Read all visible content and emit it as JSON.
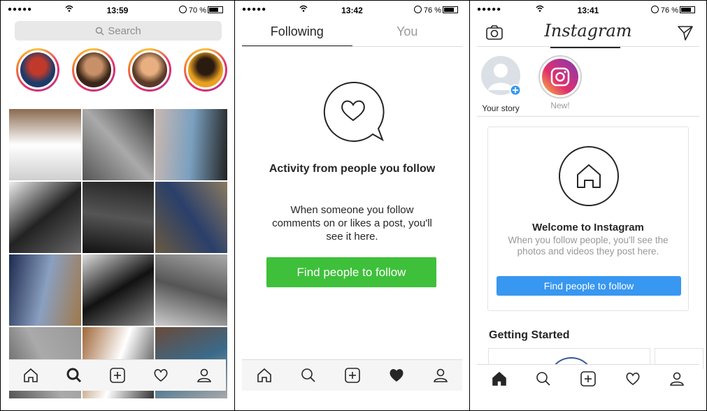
{
  "panels": [
    {
      "status": {
        "signal": "●●●●●",
        "time": "13:59",
        "battery": "70 %",
        "battery_level": 0.7
      },
      "search": {
        "placeholder": "Search"
      },
      "stories": [
        {
          "colors": [
            "#1d3a6a",
            "#c0392b"
          ]
        },
        {
          "colors": [
            "#3a2618",
            "#c89068"
          ]
        },
        {
          "colors": [
            "#5a3a28",
            "#e8b080"
          ]
        },
        {
          "colors": [
            "#e8a020",
            "#2a1a10"
          ]
        }
      ],
      "tiles": [
        {
          "name": "white-phone-photo",
          "colors": [
            "#cfcfcf",
            "#ffffff",
            "#8a6a50"
          ]
        },
        {
          "name": "phone-in-hand-photo",
          "colors": [
            "#555",
            "#aaa",
            "#333"
          ]
        },
        {
          "name": "phone-lineup-photo",
          "colors": [
            "#c9b8b0",
            "#7aa0c0",
            "#222"
          ]
        },
        {
          "name": "pc-case-photo",
          "colors": [
            "#eee",
            "#222",
            "#666"
          ]
        },
        {
          "name": "dark-laptop-photo",
          "colors": [
            "#111",
            "#555",
            "#222"
          ]
        },
        {
          "name": "blue-phone-ground-photo",
          "colors": [
            "#6a5a40",
            "#2a3f6a",
            "#8a7a60"
          ]
        },
        {
          "name": "galaxy-phone-photo",
          "colors": [
            "#1e2a50",
            "#8aa0c0",
            "#a0784a"
          ]
        },
        {
          "name": "black-phone-photo",
          "colors": [
            "#ddd",
            "#111",
            "#888"
          ]
        },
        {
          "name": "silver-phone-photo",
          "colors": [
            "#ccc",
            "#555",
            "#aaa"
          ]
        },
        {
          "name": "gadget-photo-1",
          "colors": [
            "#555",
            "#aaa",
            "#999"
          ]
        },
        {
          "name": "gadget-photo-2",
          "colors": [
            "#a0683a",
            "#fff",
            "#333"
          ]
        },
        {
          "name": "gadget-photo-3",
          "colors": [
            "#6a4a3a",
            "#3a6a8a",
            "#aaa"
          ]
        }
      ]
    },
    {
      "status": {
        "signal": "●●●●●",
        "time": "13:42",
        "battery": "76 %",
        "battery_level": 0.76
      },
      "tabs": [
        "Following",
        "You"
      ],
      "empty_title": "Activity from people you follow",
      "empty_body": "When someone you follow comments on or likes a post, you'll see it here.",
      "cta": "Find people to follow",
      "cta_color": "#3ec03a"
    },
    {
      "status": {
        "signal": "●●●●●",
        "time": "13:41",
        "battery": "76 %",
        "battery_level": 0.76
      },
      "logo": "Instagram",
      "stories": [
        {
          "label": "Your story"
        },
        {
          "label": "New!"
        }
      ],
      "welcome_title": "Welcome to Instagram",
      "welcome_body": "When you follow people, you'll see the photos and videos they post here.",
      "cta": "Find people to follow",
      "cta_color": "#3897f0",
      "getting_started": "Getting Started"
    }
  ]
}
